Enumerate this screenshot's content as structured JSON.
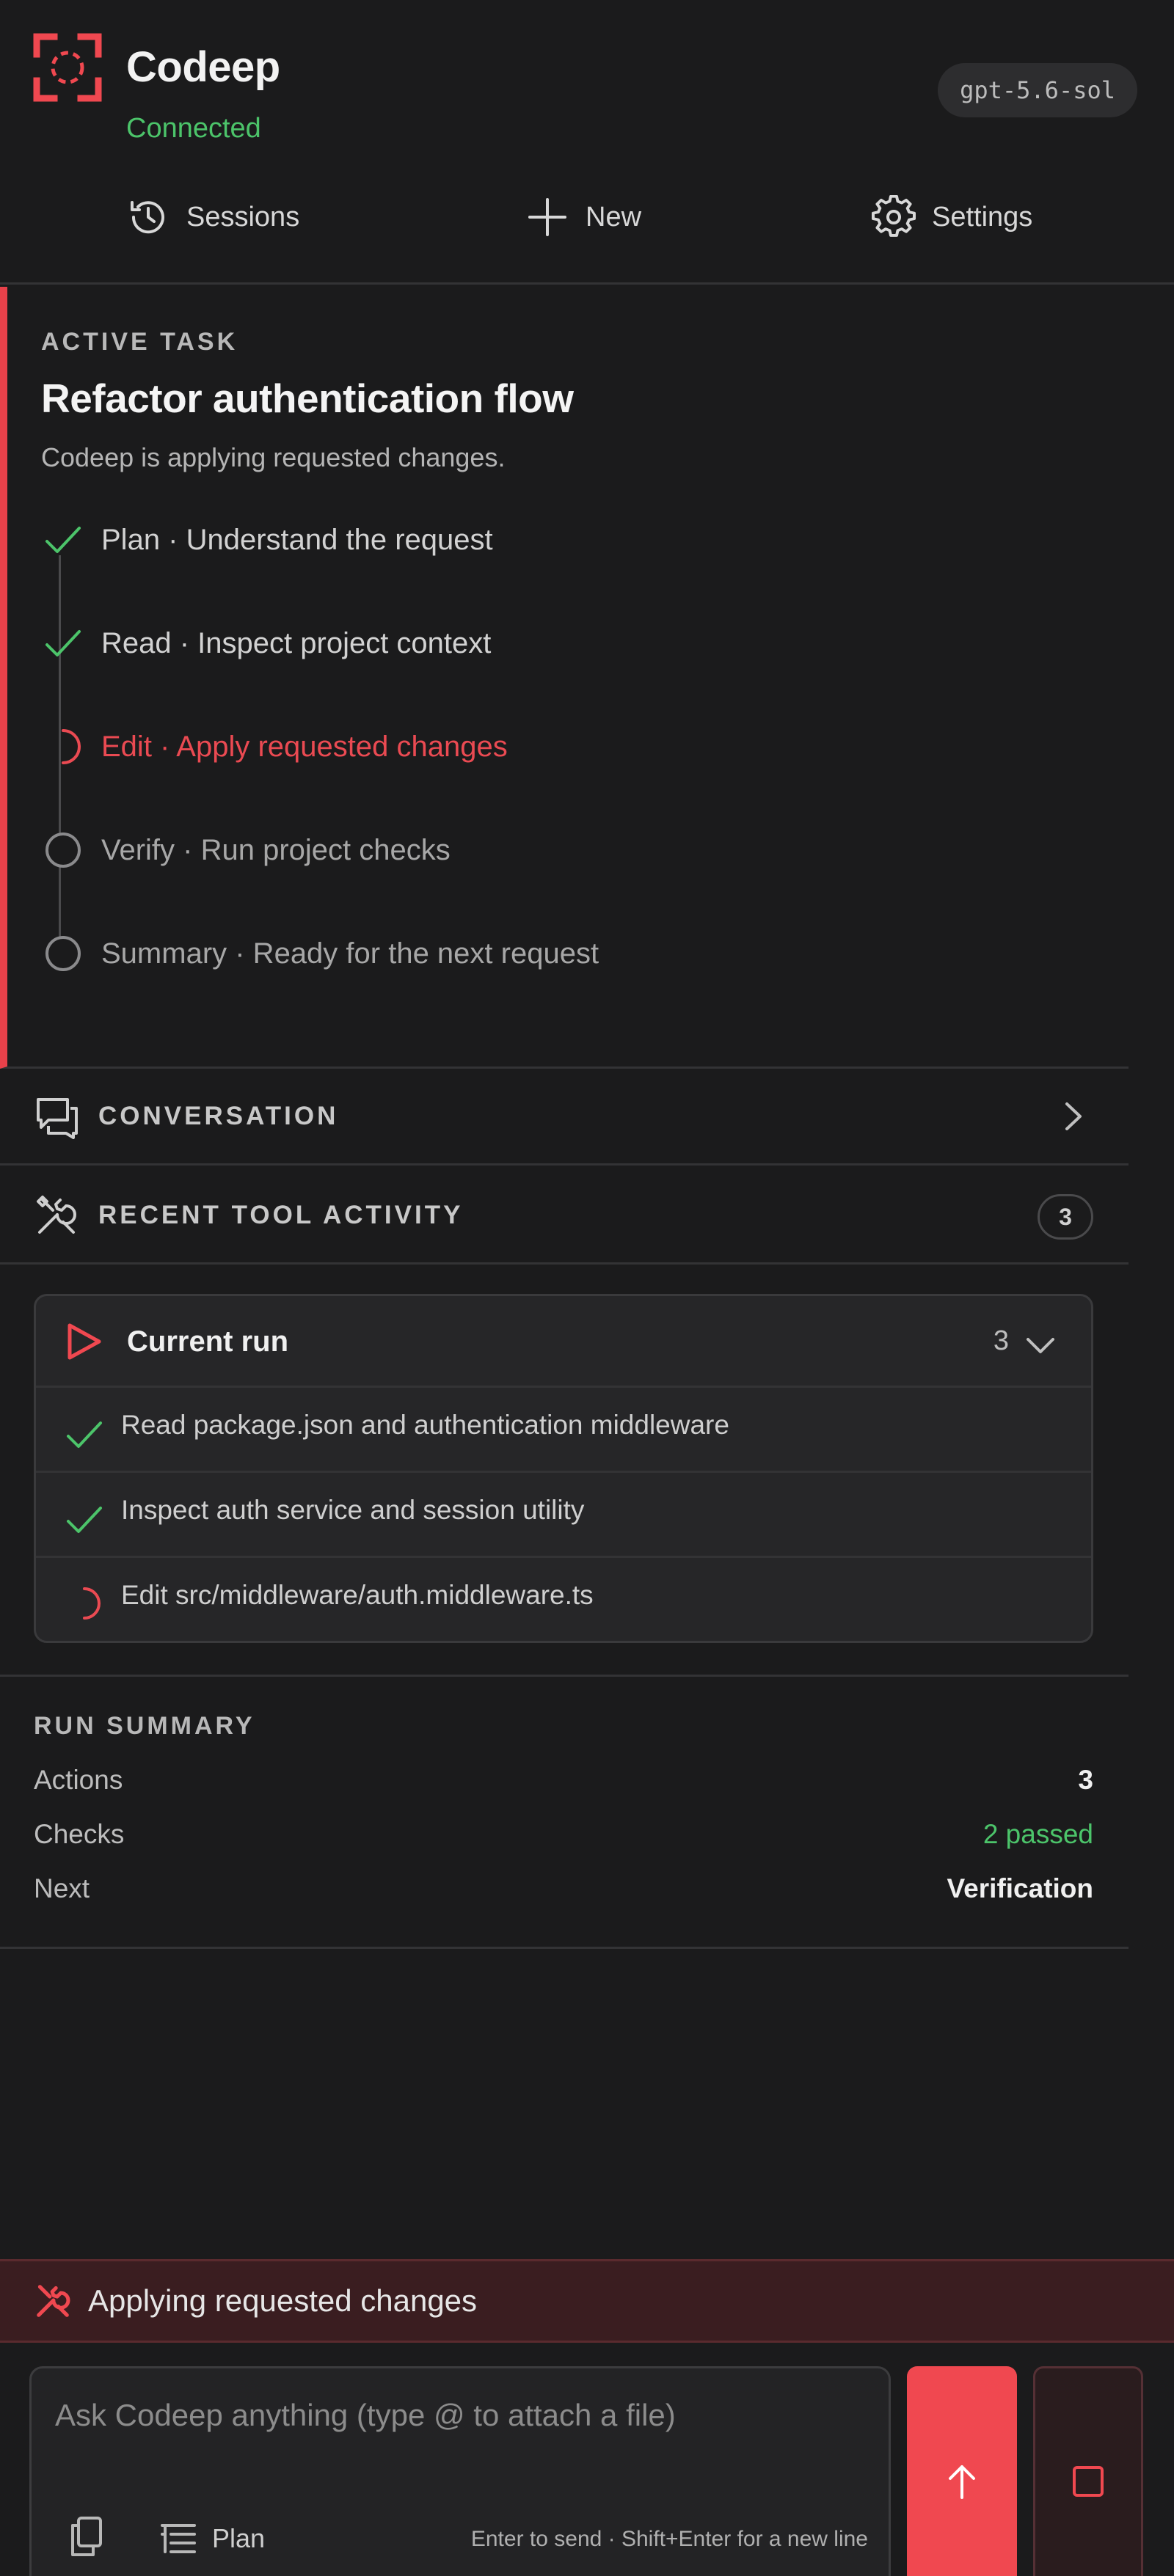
{
  "app": {
    "title": "Codeep",
    "status": "Connected",
    "model": "gpt-5.6-sol",
    "accent_color": "#f04850",
    "success_color": "#4cc46a"
  },
  "nav": {
    "sessions_label": "Sessions",
    "new_label": "New",
    "settings_label": "Settings"
  },
  "active_task": {
    "section_label": "ACTIVE TASK",
    "title": "Refactor authentication flow",
    "subtitle": "Codeep is applying requested changes.",
    "steps": [
      {
        "label": "Plan · Understand the request",
        "state": "done",
        "icon": "check-icon"
      },
      {
        "label": "Read · Inspect project context",
        "state": "done",
        "icon": "check-icon"
      },
      {
        "label": "Edit · Apply requested changes",
        "state": "in-progress",
        "icon": "spinner-icon"
      },
      {
        "label": "Verify · Run project checks",
        "state": "pending",
        "icon": "circle-icon"
      },
      {
        "label": "Summary · Ready for the next request",
        "state": "pending",
        "icon": "circle-icon"
      }
    ]
  },
  "conversation": {
    "label": "CONVERSATION"
  },
  "tool_activity": {
    "label": "RECENT TOOL ACTIVITY",
    "count": "3",
    "run": {
      "title": "Current run",
      "count": "3",
      "items": [
        {
          "label": "Read package.json and authentication middleware",
          "state": "done"
        },
        {
          "label": "Inspect auth service and session utility",
          "state": "done"
        },
        {
          "label": "Edit src/middleware/auth.middleware.ts",
          "state": "in-progress"
        }
      ]
    }
  },
  "run_summary": {
    "label": "RUN SUMMARY",
    "rows": [
      {
        "key": "Actions",
        "value": "3"
      },
      {
        "key": "Checks",
        "value": "2 passed"
      },
      {
        "key": "Next",
        "value": "Verification"
      }
    ]
  },
  "status_bar": {
    "text": "Applying requested changes"
  },
  "composer": {
    "placeholder": "Ask Codeep anything (type @ to attach a file)",
    "value": "",
    "mode_label": "Plan",
    "hint": "Enter to send · Shift+Enter for a new line"
  }
}
